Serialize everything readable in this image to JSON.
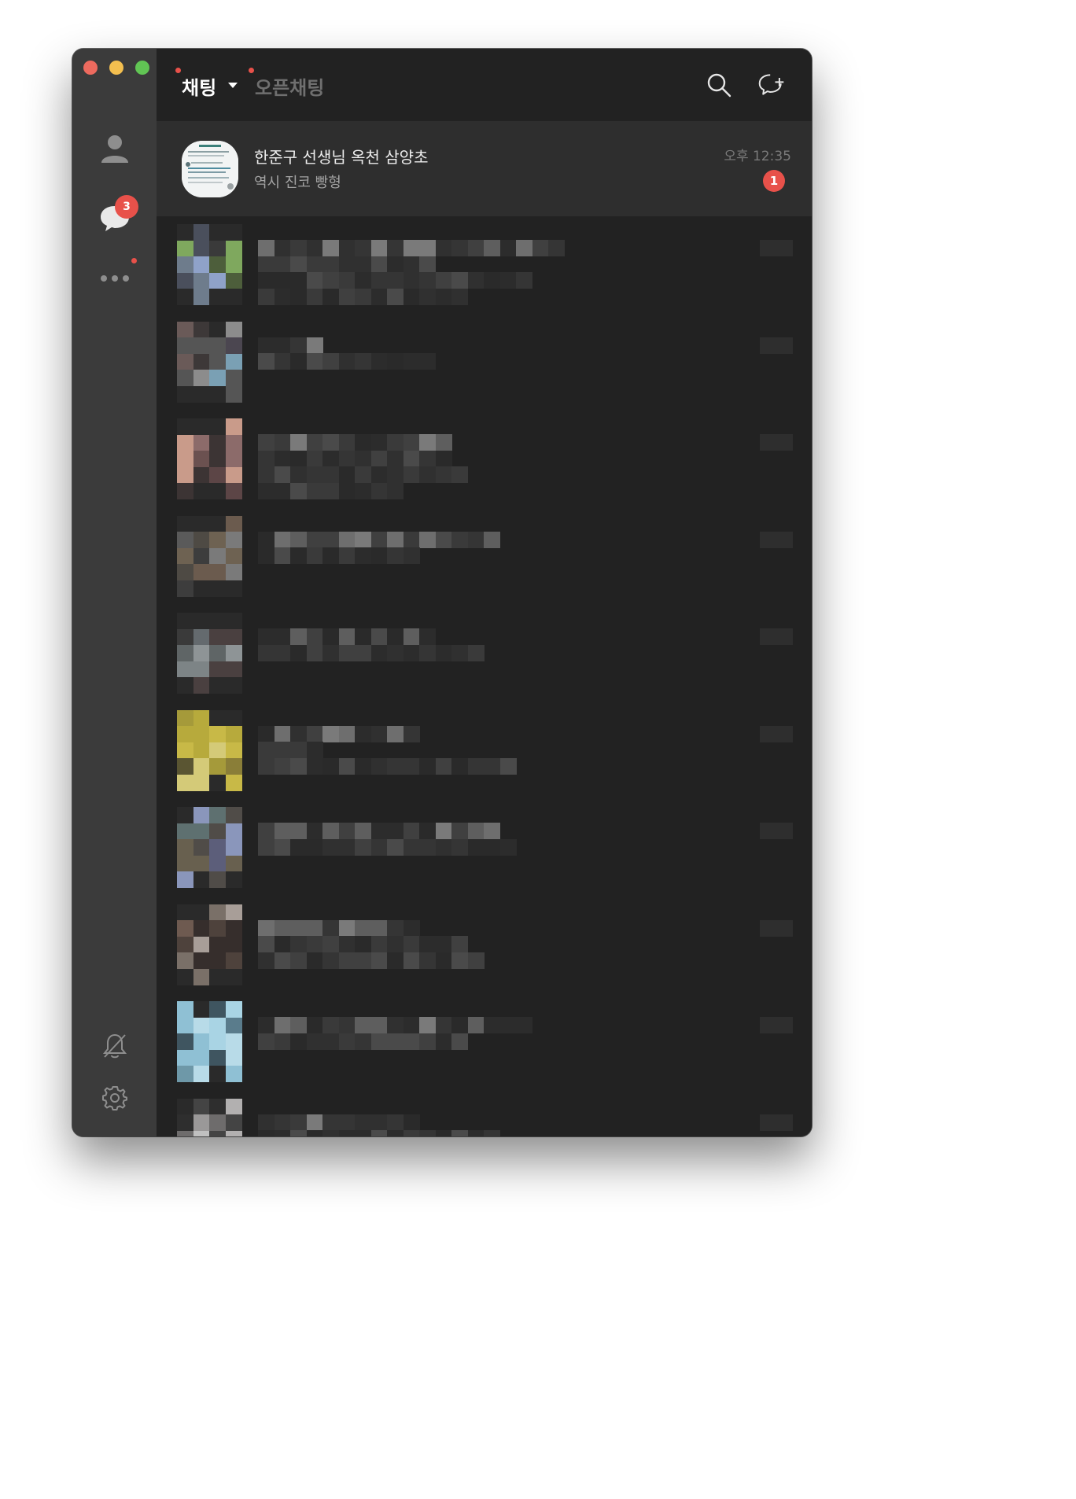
{
  "window": {
    "traffic_lights": {
      "close": "#ed6a5e",
      "minimize": "#f4bf4f",
      "zoom": "#61c554"
    }
  },
  "sidebar": {
    "items": [
      {
        "id": "friends",
        "icon": "person-icon"
      },
      {
        "id": "chats",
        "icon": "chat-bubble-icon",
        "badge": "3"
      },
      {
        "id": "more",
        "icon": "more-dots-icon"
      }
    ],
    "bottom_items": [
      {
        "id": "notifications",
        "icon": "bell-off-icon"
      },
      {
        "id": "settings",
        "icon": "gear-icon"
      }
    ]
  },
  "header": {
    "tab_chat": "채팅",
    "tab_open_chat": "오픈채팅",
    "search_icon": "search-icon",
    "new_chat_icon": "new-chat-icon"
  },
  "chats": [
    {
      "name": "한준구 선생님 옥천 삼양초",
      "last_message": "역시 진코 빵형",
      "time": "오후 12:35",
      "unread": "1"
    }
  ],
  "colors": {
    "accent_badge": "#e8514a",
    "sidebar_bg": "#3b3b3b",
    "list_bg": "#222222",
    "active_row_bg": "#2e2e2e"
  }
}
